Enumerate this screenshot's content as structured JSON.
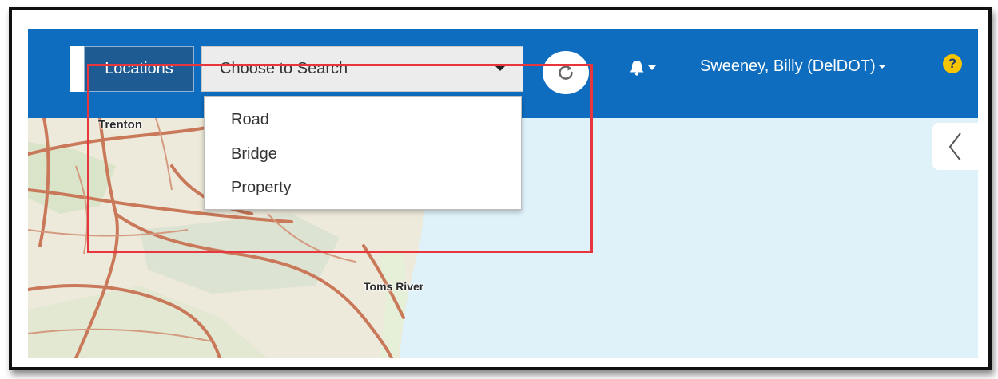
{
  "topbar": {
    "locations_label": "Locations",
    "search_select": {
      "value": "Choose to Search",
      "options": [
        "Road",
        "Bridge",
        "Property"
      ]
    },
    "user_label": "Sweeney, Billy (DelDOT)",
    "help_symbol": "?"
  },
  "map": {
    "labels": {
      "trenton": "Trenton",
      "toms_river": "Toms River"
    }
  },
  "icons": {
    "refresh": "refresh-icon",
    "bell": "bell-icon",
    "help": "help-icon",
    "collapse": "chevron-left-icon"
  },
  "colors": {
    "topbar": "#0e6dbf",
    "locations_button": "#1e5b93",
    "highlight": "#e8363f",
    "help": "#f6c400",
    "water": "#dff2fa",
    "land": "#eeeadb",
    "roads": "#c9795a"
  }
}
